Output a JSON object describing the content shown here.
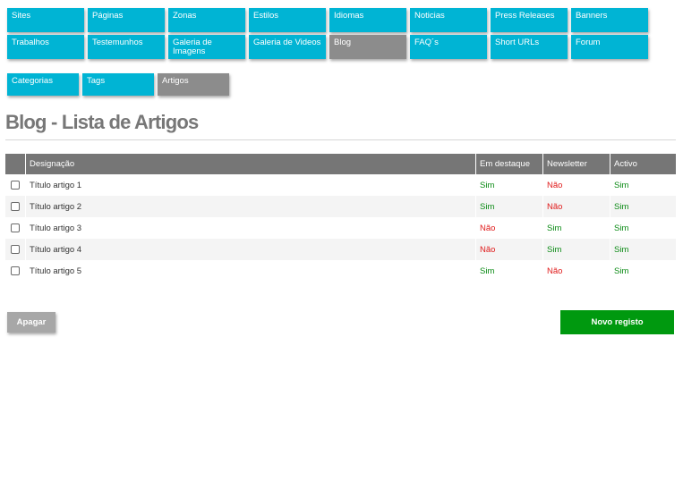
{
  "nav": {
    "row1": [
      {
        "label": "Sites",
        "active": false
      },
      {
        "label": "Páginas",
        "active": false
      },
      {
        "label": "Zonas",
        "active": false
      },
      {
        "label": "Estilos",
        "active": false
      },
      {
        "label": "Idiomas",
        "active": false
      },
      {
        "label": "Noticias",
        "active": false
      },
      {
        "label": "Press Releases",
        "active": false
      },
      {
        "label": "Banners",
        "active": false
      }
    ],
    "row2": [
      {
        "label": "Trabalhos",
        "active": false
      },
      {
        "label": "Testemunhos",
        "active": false
      },
      {
        "label": "Galeria de Imagens",
        "active": false
      },
      {
        "label": "Galeria de Videos",
        "active": false
      },
      {
        "label": "Blog",
        "active": true
      },
      {
        "label": "FAQ´s",
        "active": false
      },
      {
        "label": "Short URLs",
        "active": false
      },
      {
        "label": "Forum",
        "active": false
      }
    ]
  },
  "subnav": [
    {
      "label": "Categorias",
      "active": false
    },
    {
      "label": "Tags",
      "active": false
    },
    {
      "label": "Artigos",
      "active": true
    }
  ],
  "page": {
    "title": "Blog - Lista de Artigos"
  },
  "table": {
    "headers": [
      "",
      "Designação",
      "Em destaque",
      "Newsletter",
      "Activo"
    ],
    "rows": [
      {
        "name": "Título artigo 1",
        "featured": "Sim",
        "newsletter": "Não",
        "active": "Sim"
      },
      {
        "name": "Título artigo 2",
        "featured": "Sim",
        "newsletter": "Não",
        "active": "Sim"
      },
      {
        "name": "Título artigo 3",
        "featured": "Não",
        "newsletter": "Sim",
        "active": "Sim"
      },
      {
        "name": "Título artigo 4",
        "featured": "Não",
        "newsletter": "Sim",
        "active": "Sim"
      },
      {
        "name": "Título artigo 5",
        "featured": "Sim",
        "newsletter": "Não",
        "active": "Sim"
      }
    ]
  },
  "actions": {
    "delete_label": "Apagar",
    "new_label": "Novo registo"
  },
  "colors": {
    "nav": "#00b4d4",
    "nav_active": "#8c8c8c",
    "header": "#767676",
    "yes": "#0a8a14",
    "no": "#e01b1b",
    "new_button": "#00990f",
    "delete_button": "#a7a7a7"
  }
}
